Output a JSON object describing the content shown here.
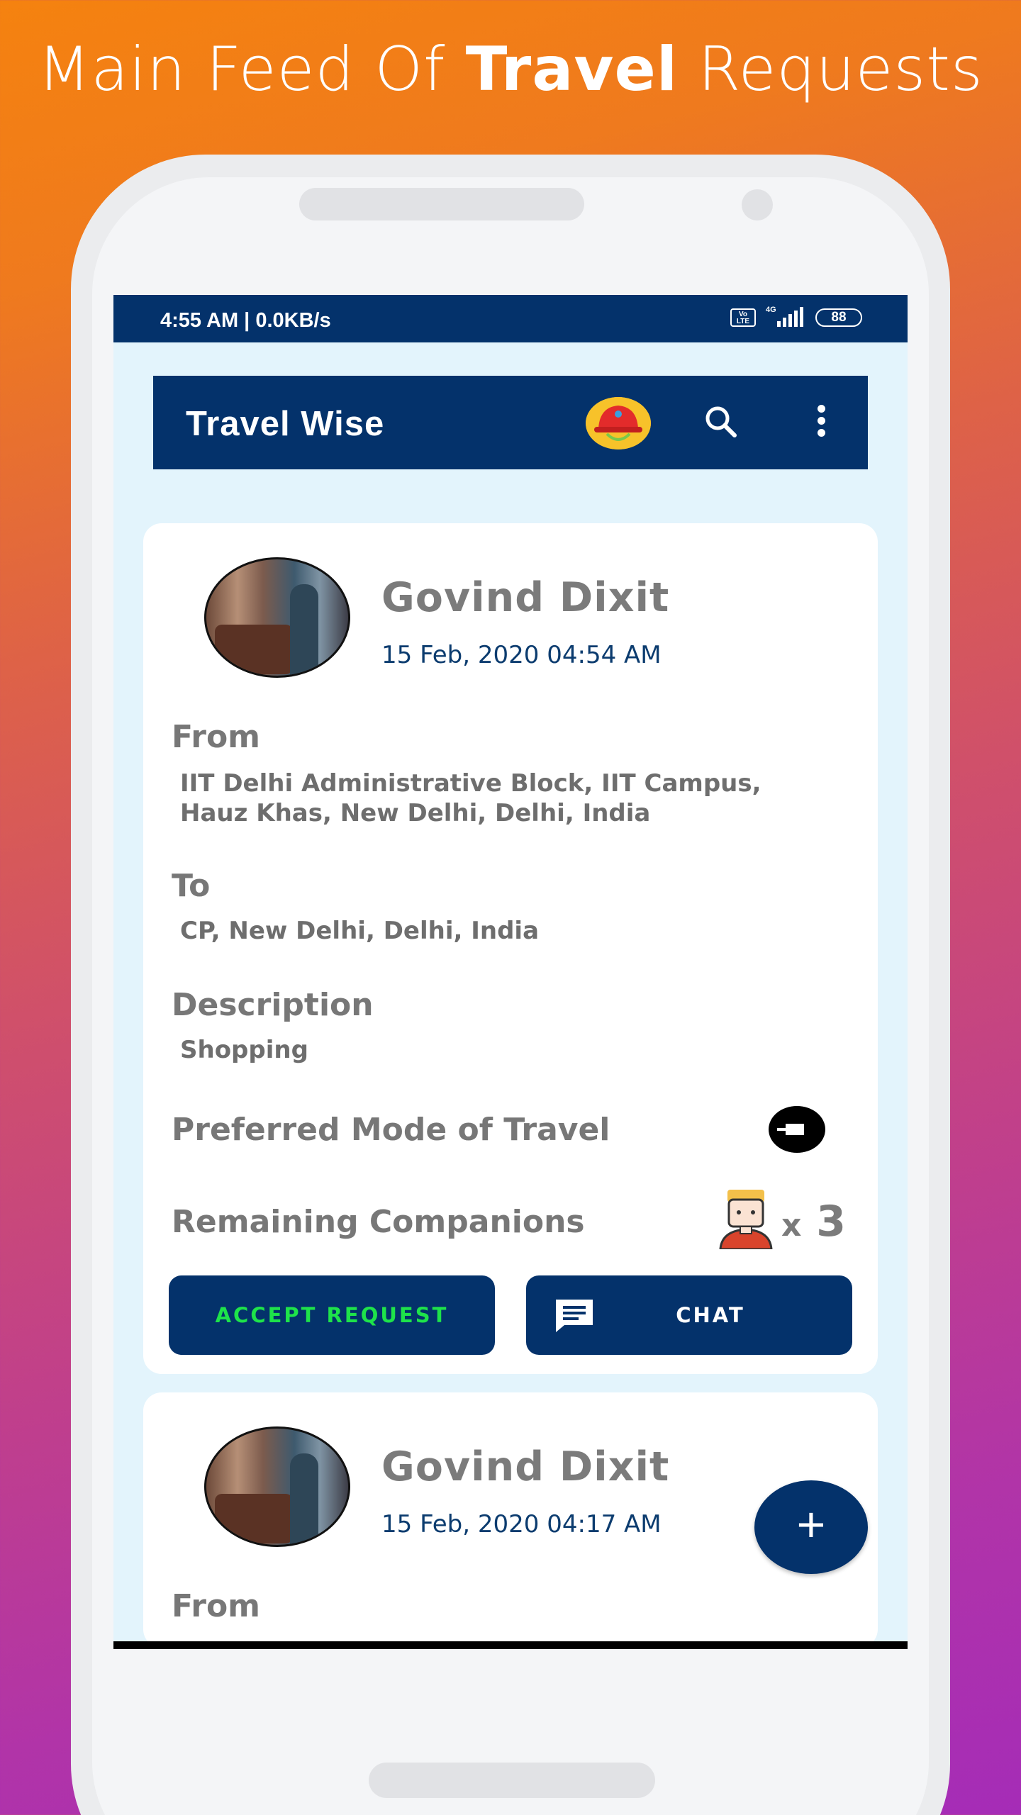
{
  "headline": {
    "part1": "Main Feed Of ",
    "bold": "Travel",
    "part2": " Requests"
  },
  "status_bar": {
    "time": "4:55 AM | 0.0KB/s",
    "volte": "Vo LTE",
    "network": "4G",
    "battery": "88"
  },
  "app_bar": {
    "title": "Travel Wise"
  },
  "cards": [
    {
      "name": "Govind Dixit",
      "date": "15 Feb, 2020 04:54 AM",
      "from_label": "From",
      "from_value": "IIT Delhi Administrative Block, IIT Campus, Hauz Khas, New Delhi, Delhi, India",
      "to_label": "To",
      "to_value": "CP, New Delhi, Delhi, India",
      "description_label": "Description",
      "description_value": "Shopping",
      "mode_label": "Preferred Mode of Travel",
      "mode_icon": "uber-icon",
      "companions_label": "Remaining Companions",
      "companions_prefix": "x",
      "companions_count": "3",
      "accept_label": "ACCEPT REQUEST",
      "chat_label": "CHAT"
    },
    {
      "name": "Govind Dixit",
      "date": "15 Feb, 2020 04:17 AM",
      "from_label": "From"
    }
  ],
  "fab": {
    "label": "+"
  },
  "colors": {
    "primary": "#04326b",
    "accept_text": "#1ee34a",
    "screen_bg": "#e3f4fc"
  }
}
